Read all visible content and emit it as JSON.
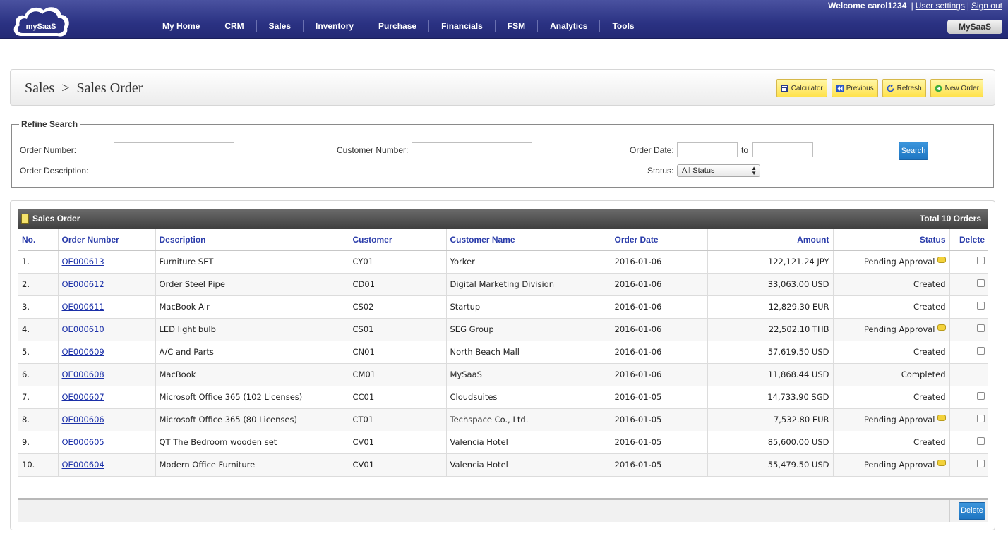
{
  "header": {
    "logo_text": "mySaaS",
    "welcome_prefix": "Welcome",
    "username": "carol1234",
    "user_settings": "User settings",
    "sign_out": "Sign out",
    "separator": "|",
    "app_badge": "MySaaS",
    "nav": [
      "My Home",
      "CRM",
      "Sales",
      "Inventory",
      "Purchase",
      "Financials",
      "FSM",
      "Analytics",
      "Tools"
    ]
  },
  "title": {
    "crumb_parent": "Sales",
    "crumb_sep": ">",
    "crumb_current": "Sales Order",
    "buttons": {
      "calculator": "Calculator",
      "previous": "Previous",
      "refresh": "Refresh",
      "new_order": "New Order"
    }
  },
  "refine": {
    "legend": "Refine Search",
    "order_number_label": "Order Number:",
    "order_number_value": "",
    "order_description_label": "Order Description:",
    "order_description_value": "",
    "customer_number_label": "Customer Number:",
    "customer_number_value": "",
    "order_date_label": "Order Date:",
    "order_date_from": "",
    "to_label": "to",
    "order_date_to": "",
    "status_label": "Status:",
    "status_selected": "All Status",
    "search_button": "Search"
  },
  "orders": {
    "panel_title": "Sales Order",
    "total": "Total 10 Orders",
    "columns": [
      "No.",
      "Order Number",
      "Description",
      "Customer",
      "Customer Name",
      "Order Date",
      "Amount",
      "Status",
      "Delete"
    ],
    "rows": [
      {
        "no": "1.",
        "order": "OE000613",
        "desc": "Furniture SET",
        "cust": "CY01",
        "name": "Yorker",
        "date": "2016-01-06",
        "amount": "122,121.24 JPY",
        "status": "Pending Approval",
        "note": true,
        "deletable": true
      },
      {
        "no": "2.",
        "order": "OE000612",
        "desc": "Order Steel Pipe",
        "cust": "CD01",
        "name": "Digital Marketing Division",
        "date": "2016-01-06",
        "amount": "33,063.00 USD",
        "status": "Created",
        "note": false,
        "deletable": true
      },
      {
        "no": "3.",
        "order": "OE000611",
        "desc": "MacBook Air",
        "cust": "CS02",
        "name": "Startup",
        "date": "2016-01-06",
        "amount": "12,829.30 EUR",
        "status": "Created",
        "note": false,
        "deletable": true
      },
      {
        "no": "4.",
        "order": "OE000610",
        "desc": "LED light bulb",
        "cust": "CS01",
        "name": "SEG Group",
        "date": "2016-01-06",
        "amount": "22,502.10 THB",
        "status": "Pending Approval",
        "note": true,
        "deletable": true
      },
      {
        "no": "5.",
        "order": "OE000609",
        "desc": "A/C and Parts",
        "cust": "CN01",
        "name": "North Beach Mall",
        "date": "2016-01-06",
        "amount": "57,619.50 USD",
        "status": "Created",
        "note": false,
        "deletable": true
      },
      {
        "no": "6.",
        "order": "OE000608",
        "desc": "MacBook",
        "cust": "CM01",
        "name": "MySaaS",
        "date": "2016-01-06",
        "amount": "11,868.44 USD",
        "status": "Completed",
        "note": false,
        "deletable": false
      },
      {
        "no": "7.",
        "order": "OE000607",
        "desc": "Microsoft Office 365 (102 Licenses)",
        "cust": "CC01",
        "name": "Cloudsuites",
        "date": "2016-01-05",
        "amount": "14,733.90 SGD",
        "status": "Created",
        "note": false,
        "deletable": true
      },
      {
        "no": "8.",
        "order": "OE000606",
        "desc": "Microsoft Office 365 (80 Licenses)",
        "cust": "CT01",
        "name": "Techspace Co., Ltd.",
        "date": "2016-01-05",
        "amount": "7,532.80 EUR",
        "status": "Pending Approval",
        "note": true,
        "deletable": true
      },
      {
        "no": "9.",
        "order": "OE000605",
        "desc": "QT The Bedroom wooden set",
        "cust": "CV01",
        "name": "Valencia Hotel",
        "date": "2016-01-05",
        "amount": "85,600.00 USD",
        "status": "Created",
        "note": false,
        "deletable": true
      },
      {
        "no": "10.",
        "order": "OE000604",
        "desc": "Modern Office Furniture",
        "cust": "CV01",
        "name": "Valencia Hotel",
        "date": "2016-01-05",
        "amount": "55,479.50 USD",
        "status": "Pending Approval",
        "note": true,
        "deletable": true
      }
    ],
    "delete_button": "Delete"
  }
}
